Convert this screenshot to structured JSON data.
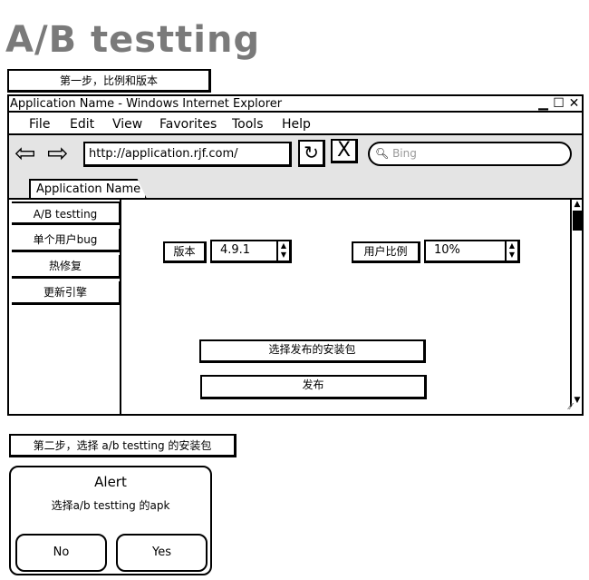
{
  "page_title": "A/B testting",
  "step1_note": "第一步，比例和版本",
  "step2_note": "第二步，选择 a/b testting 的安装包",
  "browser": {
    "title": "Application Name - Windows Internet Explorer",
    "minimize": "▁",
    "maximize": "☐",
    "close": "✕",
    "menu": [
      "File",
      "Edit",
      "View",
      "Favorites",
      "Tools",
      "Help"
    ],
    "back": "⇦",
    "forward": "⇨",
    "url": "http://application.rjf.com/",
    "refresh": "↻",
    "stop": "X",
    "search_placeholder": "Bing",
    "tab_label": "Application Name"
  },
  "sidebar": {
    "items": [
      {
        "label": "A/B testting"
      },
      {
        "label": "单个用户bug"
      },
      {
        "label": "热修复"
      },
      {
        "label": "更新引擎"
      }
    ]
  },
  "form": {
    "version_label": "版本",
    "version_value": "4.9.1",
    "ratio_label": "用户比例",
    "ratio_value": "10%",
    "select_package_button": "选择发布的安装包",
    "publish_button": "发布"
  },
  "alert": {
    "title": "Alert",
    "message": "选择a/b testting 的apk",
    "no_label": "No",
    "yes_label": "Yes"
  }
}
